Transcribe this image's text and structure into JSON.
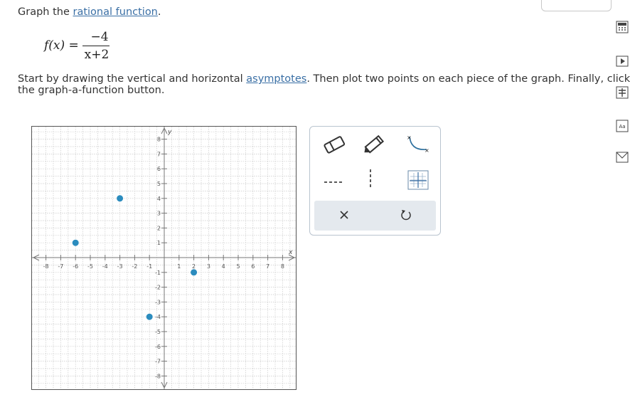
{
  "intro": {
    "prefix": "Graph the ",
    "link": "rational function",
    "suffix": "."
  },
  "formula": {
    "lhs": "f(x) =",
    "numerator": "−4",
    "denominator": "x+2"
  },
  "instructions": {
    "part1": "Start by drawing the vertical and horizontal ",
    "link": "asymptotes",
    "part2": ". Then plot two points on each piece of the graph. Finally, click on",
    "line2": "the graph-a-function button."
  },
  "graph": {
    "x_axis_label": "x",
    "y_axis_label": "y",
    "x_range": [
      -8,
      8
    ],
    "y_range": [
      -8,
      8
    ],
    "x_tick_labels": [
      "-8",
      "-7",
      "-6",
      "-5",
      "-4",
      "-3",
      "-2",
      "-1",
      "1",
      "2",
      "3",
      "4",
      "5",
      "6",
      "7",
      "8"
    ],
    "y_tick_labels": [
      "8",
      "7",
      "6",
      "5",
      "4",
      "3",
      "2",
      "1",
      "-1",
      "-2",
      "-3",
      "-4",
      "-5",
      "-6",
      "-7",
      "-8"
    ],
    "plotted_points": [
      {
        "x": -6,
        "y": 1
      },
      {
        "x": -3,
        "y": 4
      },
      {
        "x": -1,
        "y": -4
      },
      {
        "x": 2,
        "y": -1
      }
    ],
    "point_color": "#2b8cbe"
  },
  "tools": {
    "eraser": "eraser-icon",
    "pencil": "pencil-icon",
    "curve": "curve-function-icon",
    "dashed_line": "dashed-line-icon",
    "vertical_dashed": "vertical-asymptote-icon",
    "graph_function": "graph-a-function-icon",
    "clear": "close-icon",
    "undo": "undo-icon"
  },
  "sidebar": [
    "calculator-icon",
    "play-icon",
    "table-icon",
    "glossary-icon",
    "mail-icon"
  ],
  "sidebar_aa": "Aa"
}
